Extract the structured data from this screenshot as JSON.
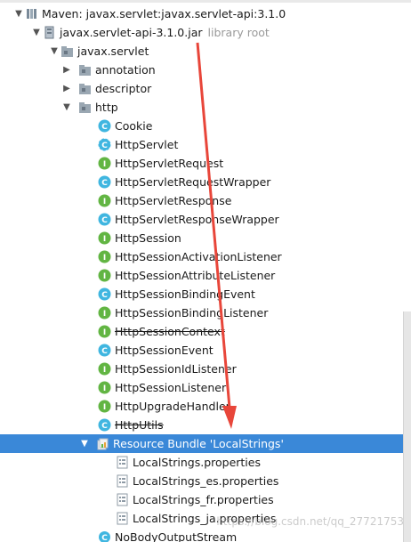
{
  "tree": {
    "root": {
      "label": "Maven: javax.servlet:javax.servlet-api:3.1.0"
    },
    "jar": {
      "label": "javax.servlet-api-3.1.0.jar",
      "hint": "library root"
    },
    "package": {
      "label": "javax.servlet"
    },
    "subpackages": [
      {
        "label": "annotation"
      },
      {
        "label": "descriptor"
      },
      {
        "label": "http"
      }
    ],
    "http_items": [
      {
        "label": "Cookie",
        "kind": "class",
        "deprecated": false
      },
      {
        "label": "HttpServlet",
        "kind": "abstract-class",
        "deprecated": false
      },
      {
        "label": "HttpServletRequest",
        "kind": "interface",
        "deprecated": false
      },
      {
        "label": "HttpServletRequestWrapper",
        "kind": "class",
        "deprecated": false
      },
      {
        "label": "HttpServletResponse",
        "kind": "interface",
        "deprecated": false
      },
      {
        "label": "HttpServletResponseWrapper",
        "kind": "class",
        "deprecated": false
      },
      {
        "label": "HttpSession",
        "kind": "interface",
        "deprecated": false
      },
      {
        "label": "HttpSessionActivationListener",
        "kind": "interface",
        "deprecated": false
      },
      {
        "label": "HttpSessionAttributeListener",
        "kind": "interface",
        "deprecated": false
      },
      {
        "label": "HttpSessionBindingEvent",
        "kind": "class",
        "deprecated": false
      },
      {
        "label": "HttpSessionBindingListener",
        "kind": "interface",
        "deprecated": false
      },
      {
        "label": "HttpSessionContext",
        "kind": "interface",
        "deprecated": true
      },
      {
        "label": "HttpSessionEvent",
        "kind": "class",
        "deprecated": false
      },
      {
        "label": "HttpSessionIdListener",
        "kind": "interface",
        "deprecated": false
      },
      {
        "label": "HttpSessionListener",
        "kind": "interface",
        "deprecated": false
      },
      {
        "label": "HttpUpgradeHandler",
        "kind": "interface",
        "deprecated": false
      },
      {
        "label": "HttpUtils",
        "kind": "class",
        "deprecated": true
      }
    ],
    "bundle": {
      "label": "Resource Bundle 'LocalStrings'"
    },
    "bundle_files": [
      {
        "label": "LocalStrings.properties"
      },
      {
        "label": "LocalStrings_es.properties"
      },
      {
        "label": "LocalStrings_fr.properties"
      },
      {
        "label": "LocalStrings_ja.properties"
      }
    ],
    "last_item": {
      "label": "NoBodyOutputStream",
      "kind": "class"
    }
  },
  "watermark": "https://blog.csdn.net/qq_27721753",
  "colors": {
    "selection": "#3a88d8",
    "class_icon": "#40b6e0",
    "interface_icon": "#62b543",
    "annotation_red": "#e8463a"
  },
  "icons": {
    "library": "library-icon",
    "jar": "jar-icon",
    "package": "package-icon",
    "class": "class-icon",
    "interface": "interface-icon",
    "resource_bundle": "resource-bundle-icon",
    "properties_file": "properties-file-icon"
  }
}
